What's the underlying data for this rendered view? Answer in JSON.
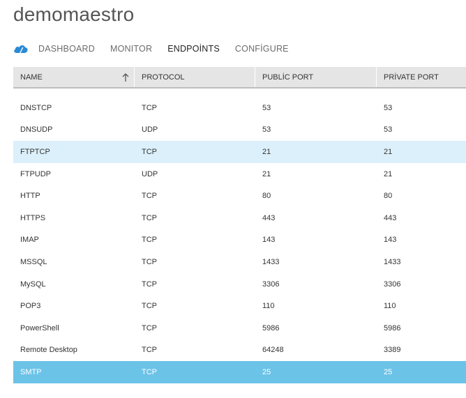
{
  "app": {
    "title": "demomaestro"
  },
  "nav": {
    "tabs": [
      {
        "label": "DASHBOARD",
        "active": false
      },
      {
        "label": "MONITOR",
        "active": false
      },
      {
        "label": "ENDPOİNTS",
        "active": true
      },
      {
        "label": "CONFİGURE",
        "active": false
      }
    ],
    "logo_icon": "cloud-service-icon"
  },
  "table": {
    "columns": [
      "NAME",
      "PROTOCOL",
      "PUBLİC PORT",
      "PRİVATE PORT"
    ],
    "sort_icon": "sort-up-arrow-icon",
    "rows": [
      {
        "name": "DNSTCP",
        "protocol": "TCP",
        "public_port": "53",
        "private_port": "53"
      },
      {
        "name": "DNSUDP",
        "protocol": "UDP",
        "public_port": "53",
        "private_port": "53"
      },
      {
        "name": "FTPTCP",
        "protocol": "TCP",
        "public_port": "21",
        "private_port": "21"
      },
      {
        "name": "FTPUDP",
        "protocol": "UDP",
        "public_port": "21",
        "private_port": "21"
      },
      {
        "name": "HTTP",
        "protocol": "TCP",
        "public_port": "80",
        "private_port": "80"
      },
      {
        "name": "HTTPS",
        "protocol": "TCP",
        "public_port": "443",
        "private_port": "443"
      },
      {
        "name": "IMAP",
        "protocol": "TCP",
        "public_port": "143",
        "private_port": "143"
      },
      {
        "name": "MSSQL",
        "protocol": "TCP",
        "public_port": "1433",
        "private_port": "1433"
      },
      {
        "name": "MySQL",
        "protocol": "TCP",
        "public_port": "3306",
        "private_port": "3306"
      },
      {
        "name": "POP3",
        "protocol": "TCP",
        "public_port": "110",
        "private_port": "110"
      },
      {
        "name": "PowerShell",
        "protocol": "TCP",
        "public_port": "5986",
        "private_port": "5986"
      },
      {
        "name": "Remote Desktop",
        "protocol": "TCP",
        "public_port": "64248",
        "private_port": "3389"
      },
      {
        "name": "SMTP",
        "protocol": "TCP",
        "public_port": "25",
        "private_port": "25"
      }
    ],
    "hover_row": 2,
    "selected_row": 12
  },
  "colors": {
    "accent": "#2a8ad6",
    "hover": "#dcf0fb",
    "selected": "#6cc3e8"
  }
}
